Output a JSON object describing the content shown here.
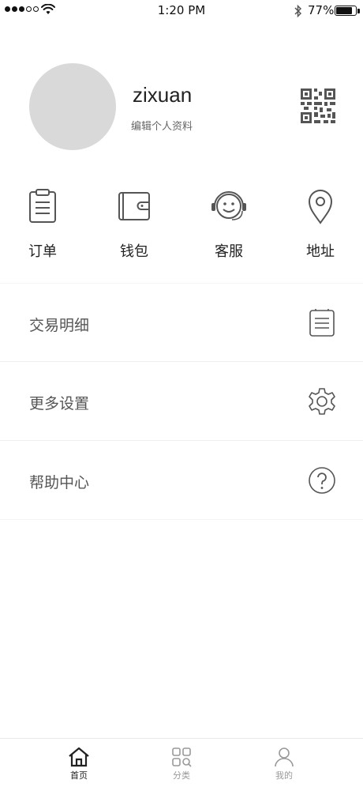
{
  "status_bar": {
    "time": "1:20 PM",
    "battery_percent": "77%",
    "battery_level": 0.77,
    "signal_bars": 3,
    "signal_bars_total": 5
  },
  "profile": {
    "username": "zixuan",
    "edit_label": "编辑个人资料",
    "qr_icon": "qr-code-icon"
  },
  "quick_menu": [
    {
      "label": "订单",
      "icon": "clipboard-icon"
    },
    {
      "label": "钱包",
      "icon": "wallet-icon"
    },
    {
      "label": "客服",
      "icon": "customer-service-icon"
    },
    {
      "label": "地址",
      "icon": "location-pin-icon"
    }
  ],
  "menu_list": [
    {
      "label": "交易明细",
      "icon": "list-icon"
    },
    {
      "label": "更多设置",
      "icon": "gear-icon"
    },
    {
      "label": "帮助中心",
      "icon": "help-icon"
    }
  ],
  "tab_bar": [
    {
      "label": "首页",
      "icon": "home-icon",
      "active": true
    },
    {
      "label": "分类",
      "icon": "category-icon",
      "active": false
    },
    {
      "label": "我的",
      "icon": "user-icon",
      "active": false
    }
  ],
  "colors": {
    "text_primary": "#222222",
    "text_secondary": "#666666",
    "icon": "#555555",
    "avatar_placeholder": "#d9d9d9",
    "tab_inactive": "#999999"
  }
}
